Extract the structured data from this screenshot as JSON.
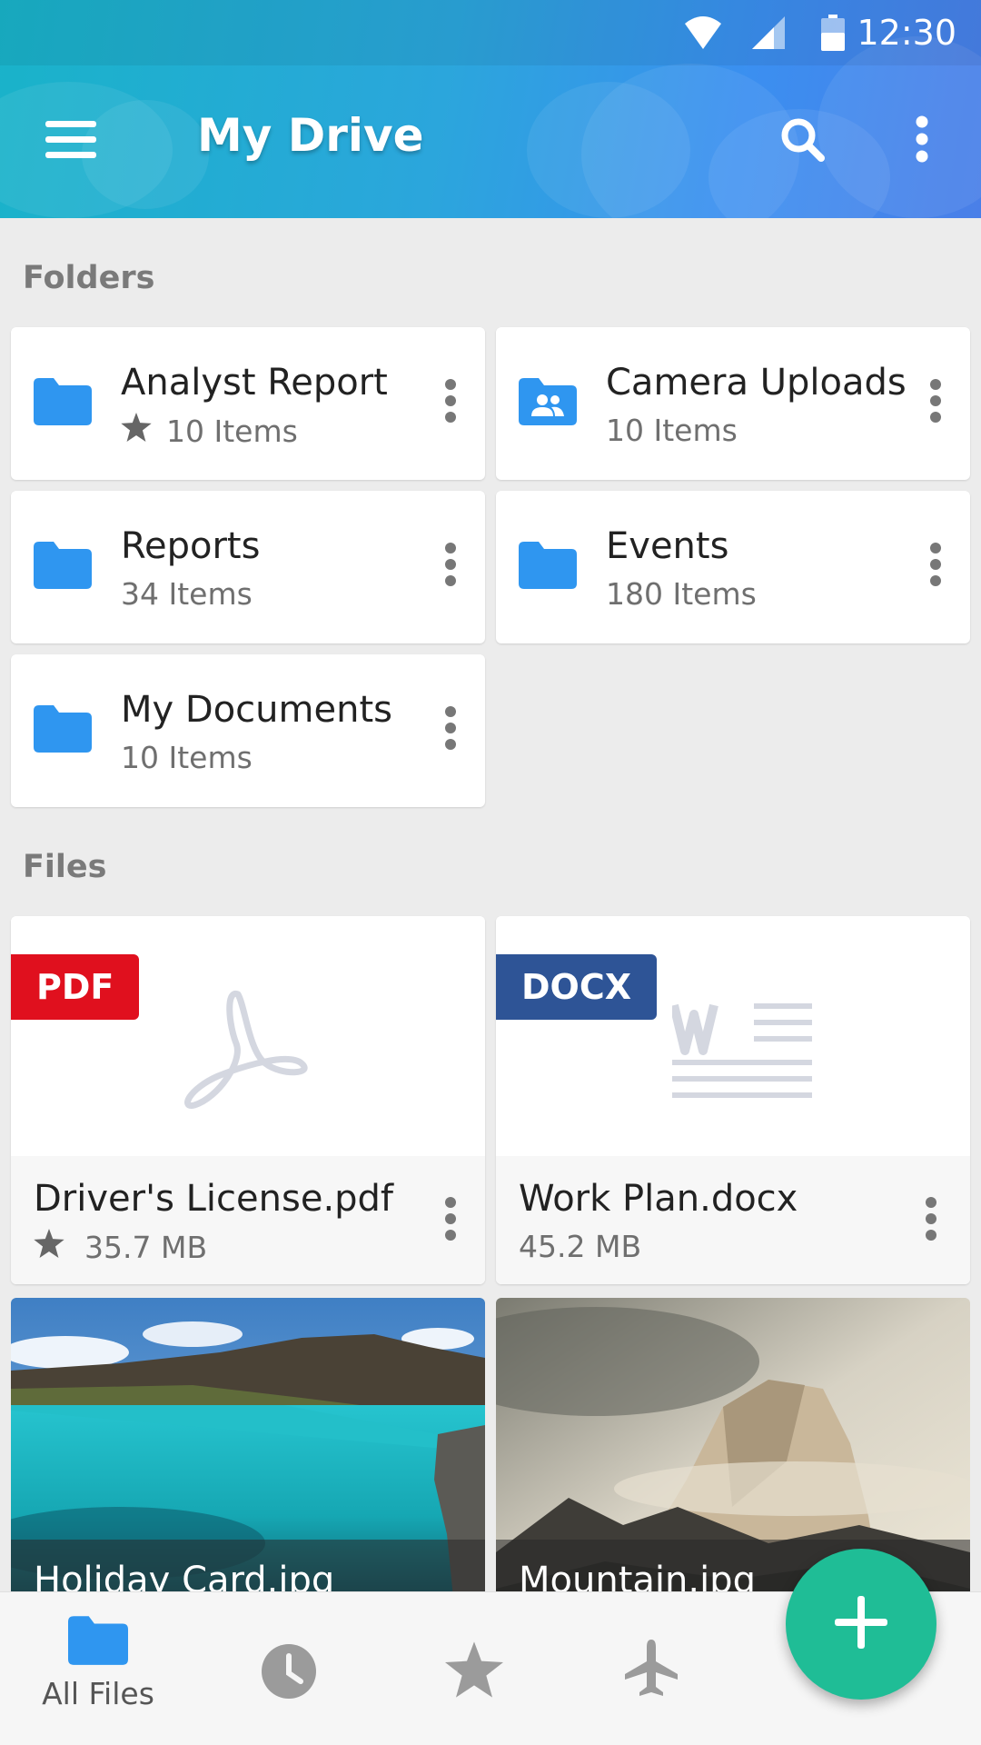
{
  "status_bar": {
    "time": "12:30"
  },
  "app_bar": {
    "title": "My Drive",
    "icons": [
      "menu-icon",
      "search-icon",
      "more-vert-icon"
    ]
  },
  "folders": {
    "label": "Folders",
    "items": [
      {
        "name": "Analyst Report",
        "count": "10 Items",
        "starred": true,
        "icon": "folder-icon"
      },
      {
        "name": "Camera Uploads",
        "count": "10 Items",
        "starred": false,
        "icon": "shared-folder-icon"
      },
      {
        "name": "Reports",
        "count": "34 Items",
        "starred": false,
        "icon": "folder-icon"
      },
      {
        "name": "Events",
        "count": "180 Items",
        "starred": false,
        "icon": "folder-icon"
      },
      {
        "name": "My Documents",
        "count": "10 Items",
        "starred": false,
        "icon": "folder-icon"
      }
    ]
  },
  "files": {
    "label": "Files",
    "items": [
      {
        "name": "Driver's License.pdf",
        "size": "35.7 MB",
        "starred": true,
        "badge": "PDF",
        "badge_color": "#e0101e"
      },
      {
        "name": "Work Plan.docx",
        "size": "45.2 MB",
        "starred": false,
        "badge": "DOCX",
        "badge_color": "#2e5496"
      },
      {
        "name": "Holiday Card.jpg"
      },
      {
        "name": "Mountain.jpg"
      }
    ]
  },
  "bottom_nav": {
    "items": [
      {
        "label": "All Files",
        "icon": "folder-icon",
        "active": true
      },
      {
        "label": "",
        "icon": "clock-icon",
        "active": false
      },
      {
        "label": "",
        "icon": "star-icon",
        "active": false
      },
      {
        "label": "",
        "icon": "airplane-icon",
        "active": false
      }
    ]
  },
  "fab": {
    "icon": "plus-icon"
  },
  "colors": {
    "accent": "#2f96f0",
    "fab": "#1fbd96",
    "pdf": "#e0101e",
    "docx": "#2e5496"
  }
}
